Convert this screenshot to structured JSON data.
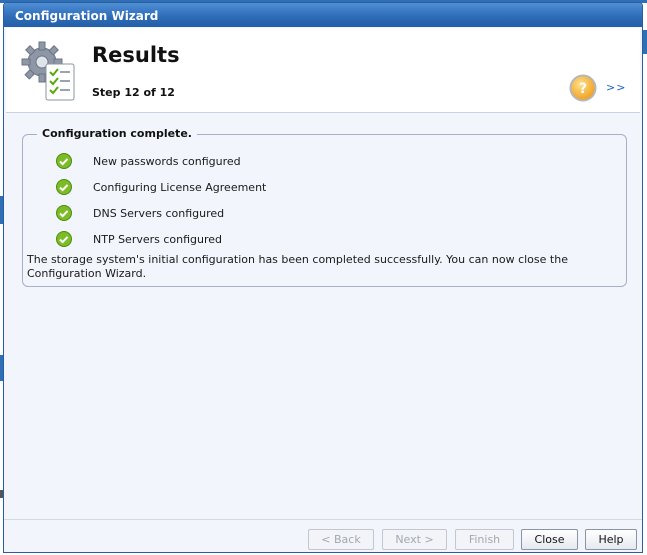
{
  "window": {
    "title": "Configuration Wizard"
  },
  "header": {
    "title": "Results",
    "step": "Step 12 of 12",
    "next_link": ">>"
  },
  "group": {
    "legend": "Configuration complete.",
    "items": [
      {
        "label": "New passwords configured",
        "status": "success"
      },
      {
        "label": "Configuring License Agreement",
        "status": "success"
      },
      {
        "label": "DNS Servers configured",
        "status": "success"
      },
      {
        "label": "NTP Servers configured",
        "status": "success"
      }
    ],
    "summary": "The storage system's initial configuration has been completed successfully. You can now close the Configuration Wizard."
  },
  "buttons": {
    "back": "< Back",
    "next": "Next >",
    "finish": "Finish",
    "close": "Close",
    "help": "Help"
  },
  "colors": {
    "titlebar": "#2f6db8",
    "accent": "#1e62c0",
    "success": "#6fb21c"
  }
}
